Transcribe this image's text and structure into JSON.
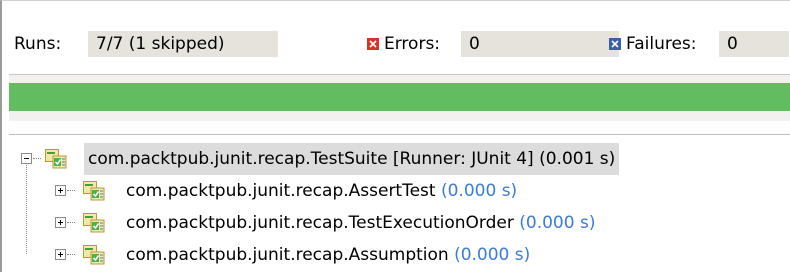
{
  "counters": {
    "runs_label": "Runs:",
    "runs_value": "7/7 (1 skipped)",
    "errors_label": "Errors:",
    "errors_value": "0",
    "failures_label": "Failures:",
    "failures_value": "0"
  },
  "progress": {
    "fraction": 1.0,
    "color": "#62bd5e"
  },
  "tree": {
    "root": {
      "name": "com.packtpub.junit.recap.TestSuite [Runner: JUnit 4]",
      "time": "(0.001 s)",
      "icon": "test-suite-ok-icon",
      "expanded": true
    },
    "children": [
      {
        "name": "com.packtpub.junit.recap.AssertTest",
        "time": "(0.000 s)",
        "icon": "test-suite-ok-icon",
        "expanded": false
      },
      {
        "name": "com.packtpub.junit.recap.TestExecutionOrder",
        "time": "(0.000 s)",
        "icon": "test-suite-ok-icon",
        "expanded": false
      },
      {
        "name": "com.packtpub.junit.recap.Assumption",
        "time": "(0.000 s)",
        "icon": "test-suite-ok-icon",
        "expanded": false
      }
    ]
  },
  "colors": {
    "error_icon": "#d9322a",
    "failure_icon": "#3a5fa8",
    "time_text": "#3a7cd6",
    "success_bar": "#62bd5e"
  }
}
